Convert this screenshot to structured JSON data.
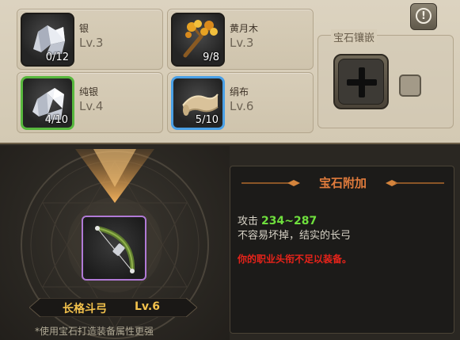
{
  "materials": [
    {
      "name": "银",
      "level": "Lv.3",
      "count": "0/12",
      "icon": "silver-ore-icon"
    },
    {
      "name": "黄月木",
      "level": "Lv.3",
      "count": "9/8",
      "icon": "yellow-moon-wood-icon"
    },
    {
      "name": "纯银",
      "level": "Lv.4",
      "count": "4/10",
      "icon": "pure-silver-ore-icon",
      "rarity_color": "#58b83e"
    },
    {
      "name": "绢布",
      "level": "Lv.6",
      "count": "5/10",
      "icon": "silk-cloth-icon",
      "rarity_color": "#4aa0e6"
    }
  ],
  "info_button": {
    "glyph": "!"
  },
  "gem_inlay": {
    "title": "宝石镶嵌",
    "slot_icon": "plus-icon"
  },
  "item": {
    "name": "长格斗弓",
    "level": "Lv.6",
    "icon": "longbow-icon",
    "frame_color": "#b17ad6"
  },
  "hint": "*使用宝石打造装备属性更强",
  "tooltip": {
    "title": "宝石附加",
    "stat_label": "攻击",
    "stat_value": "234~287",
    "description": "不容易坏掉，结实的长弓",
    "warning": "你的职业头衔不足以装备。"
  },
  "colors": {
    "stat_value": "#6fe03d",
    "warning": "#e8231a",
    "title": "#e07b3c",
    "item_name": "#f3c24c"
  }
}
